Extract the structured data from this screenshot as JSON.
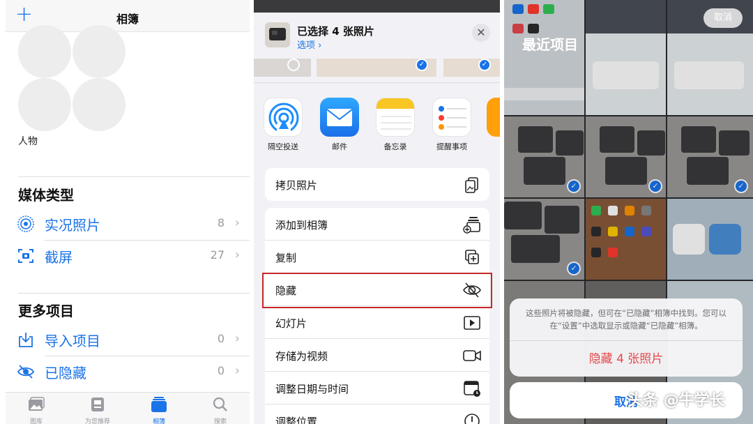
{
  "panel_albums": {
    "header": {
      "title": "相簿",
      "add_icon": "plus-icon"
    },
    "people": {
      "label": "人物"
    },
    "media_types": {
      "title": "媒体类型",
      "items": [
        {
          "label": "实况照片",
          "count": "8",
          "icon": "live-photo-icon"
        },
        {
          "label": "截屏",
          "count": "27",
          "icon": "screenshot-icon"
        }
      ]
    },
    "more_items": {
      "title": "更多项目",
      "items": [
        {
          "label": "导入项目",
          "count": "0",
          "icon": "import-icon"
        },
        {
          "label": "已隐藏",
          "count": "0",
          "icon": "hidden-eye-icon"
        }
      ]
    },
    "tabbar": [
      {
        "label": "图库",
        "icon": "library-icon",
        "active": false
      },
      {
        "label": "为您推荐",
        "icon": "for-you-icon",
        "active": false
      },
      {
        "label": "相簿",
        "icon": "albums-icon",
        "active": true
      },
      {
        "label": "搜索",
        "icon": "search-icon",
        "active": false
      }
    ]
  },
  "panel_share": {
    "header": {
      "selected": "已选择 4 张照片",
      "options": "选项 ›"
    },
    "apps": [
      {
        "label": "隔空投送",
        "icon": "airdrop-icon"
      },
      {
        "label": "邮件",
        "icon": "mail-icon"
      },
      {
        "label": "备忘录",
        "icon": "notes-icon"
      },
      {
        "label": "提醒事项",
        "icon": "reminders-icon"
      }
    ],
    "actions": [
      {
        "label": "拷贝照片",
        "icon": "copy-photo-icon"
      },
      {
        "label": "添加到相簿",
        "icon": "add-to-album-icon"
      },
      {
        "label": "复制",
        "icon": "duplicate-icon"
      },
      {
        "label": "隐藏",
        "icon": "hide-eye-icon"
      },
      {
        "label": "幻灯片",
        "icon": "slideshow-icon"
      },
      {
        "label": "存储为视频",
        "icon": "video-icon"
      },
      {
        "label": "调整日期与时间",
        "icon": "calendar-clock-icon"
      },
      {
        "label": "调整位置",
        "icon": "location-icon"
      }
    ],
    "highlighted_action": "隐藏"
  },
  "panel_confirm": {
    "title": "最近项目",
    "cancel_top": "取消",
    "alert_message": "这些照片将被隐藏，但可在“已隐藏”相簿中找到。您可以在“设置”中选取显示或隐藏“已隐藏”相簿。",
    "alert_action": "隐藏 4 张照片",
    "cancel_button": "取消"
  },
  "watermark": "头条 @牛学长",
  "colors": {
    "accent": "#1a73e8",
    "destructive": "#e5484d",
    "highlight_border": "#c62828"
  }
}
